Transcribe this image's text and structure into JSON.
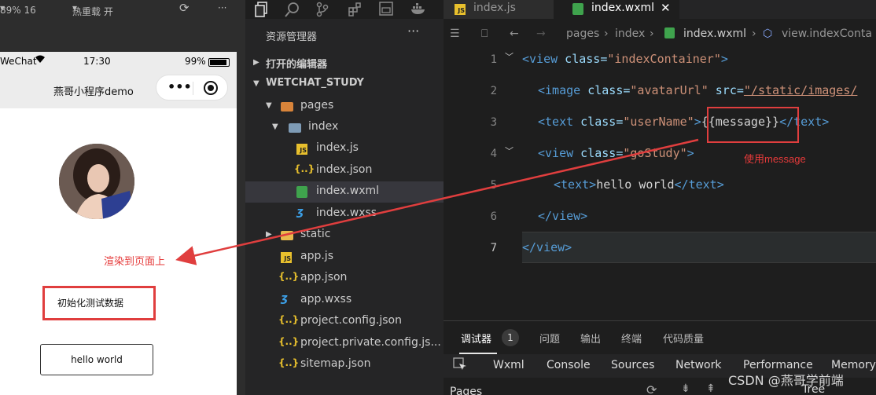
{
  "simulator": {
    "toolbar": {
      "zoom": "89% 16",
      "hot_reload": "热重载 开",
      "more": "···"
    },
    "status": {
      "carrier": "WeChat",
      "time": "17:30",
      "battery": "99%"
    },
    "nav_title": "燕哥小程序demo",
    "message_text": "初始化测试数据",
    "hello_button": "hello world",
    "annotation_render": "渲染到页面上"
  },
  "explorer": {
    "title": "资源管理器",
    "more": "···",
    "open_editors": "打开的编辑器",
    "workspace": "WETCHAT_STUDY",
    "items": [
      {
        "label": "pages"
      },
      {
        "label": "index"
      },
      {
        "label": "index.js"
      },
      {
        "label": "index.json"
      },
      {
        "label": "index.wxml"
      },
      {
        "label": "index.wxss"
      },
      {
        "label": "static"
      },
      {
        "label": "app.js"
      },
      {
        "label": "app.json"
      },
      {
        "label": "app.wxss"
      },
      {
        "label": "project.config.json"
      },
      {
        "label": "project.private.config.js..."
      },
      {
        "label": "sitemap.json"
      }
    ]
  },
  "editor": {
    "tabs": [
      {
        "label": "index.js"
      },
      {
        "label": "index.wxml"
      }
    ],
    "breadcrumbs": [
      "pages",
      "index",
      "index.wxml",
      "view.indexConta"
    ],
    "line_numbers": [
      "1",
      "2",
      "3",
      "4",
      "5",
      "6",
      "7"
    ],
    "code": {
      "l1": {
        "a": "<view",
        "b": " class=",
        "c": "\"indexContainer\"",
        "d": ">"
      },
      "l2": {
        "a": "<image",
        "b": " class=",
        "c": "\"avatarUrl\"",
        "d": " src=",
        "e": "\"/static/images/"
      },
      "l3": {
        "a": "<text",
        "b": " class=",
        "c": "\"userName\"",
        "d": ">",
        "e": "{{message}}",
        "f": "</text>"
      },
      "l4": {
        "a": "<view",
        "b": " class=",
        "c": "\"goStudy\"",
        "d": ">"
      },
      "l5": {
        "a": "<text>",
        "b": "hello world",
        "c": "</text>"
      },
      "l6": {
        "a": "</view>"
      },
      "l7": {
        "a": "</view>"
      }
    },
    "annotation_use": "使用message"
  },
  "panel": {
    "tabs": [
      "调试器",
      "问题",
      "输出",
      "终端",
      "代码质量"
    ],
    "badge": "1",
    "devtools_tabs": [
      "Wxml",
      "Console",
      "Sources",
      "Network",
      "Performance",
      "Memory"
    ],
    "pages_label": "Pages",
    "tree_label": "Tree"
  },
  "watermark": "CSDN @燕哥学前端",
  "colors": {
    "annotation_red": "#e03e3e",
    "tag": "#569cd6",
    "attr": "#9cdcfe",
    "string": "#ce9178"
  }
}
